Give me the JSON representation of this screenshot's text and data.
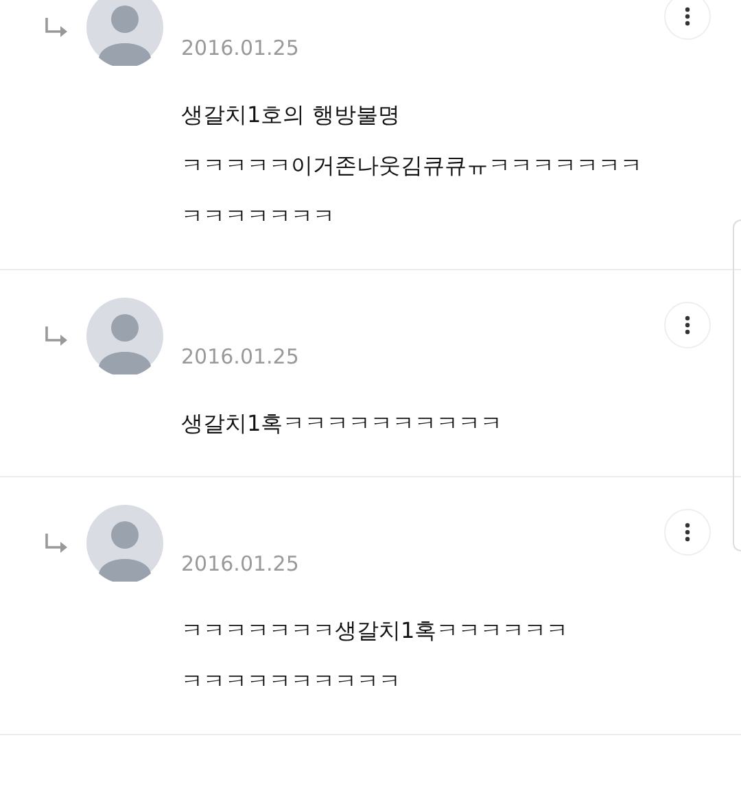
{
  "comments": [
    {
      "date": "2016.01.25",
      "lines": [
        "생갈치1호의 행방불명",
        "ㅋㅋㅋㅋㅋ이거존나웃김큐큐ㅠㅋㅋㅋㅋㅋㅋㅋ",
        "ㅋㅋㅋㅋㅋㅋㅋ"
      ]
    },
    {
      "date": "2016.01.25",
      "lines": [
        "생갈치1혹ㅋㅋㅋㅋㅋㅋㅋㅋㅋㅋ"
      ]
    },
    {
      "date": "2016.01.25",
      "lines": [
        "ㅋㅋㅋㅋㅋㅋㅋ생갈치1혹ㅋㅋㅋㅋㅋㅋ",
        "ㅋㅋㅋㅋㅋㅋㅋㅋㅋㅋ"
      ]
    }
  ]
}
